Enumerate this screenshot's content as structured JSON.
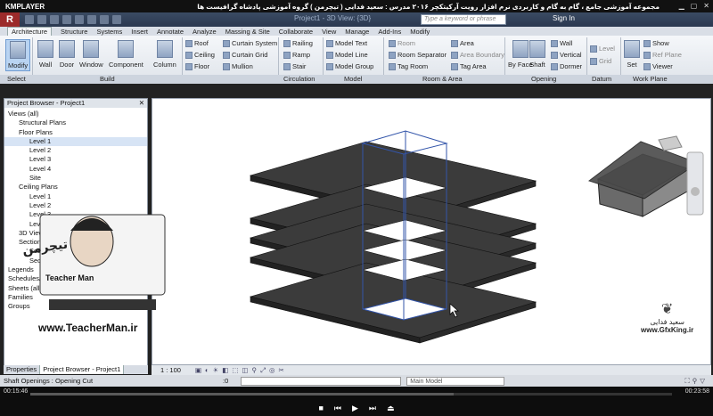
{
  "player": {
    "logo": "KMPLAYER",
    "title": "مجموعه آموزشی جامع ، گام به گام و کاربردی نرم افزار رویت آرکیتکچر ۲۰۱۶ مدرس : سعید فدایی ( تیچرمن ) گروه آموزشی پادشاه گرافیست ها",
    "time_current": "00:15:46",
    "time_total": "00:23:58",
    "progress": 0.66
  },
  "app": {
    "logo": "R",
    "window_title": "Project1 - 3D View: {3D}",
    "search_placeholder": "Type a keyword or phrase",
    "sign_in": "Sign In",
    "tabs": [
      "Architecture",
      "Structure",
      "Systems",
      "Insert",
      "Annotate",
      "Analyze",
      "Massing & Site",
      "Collaborate",
      "View",
      "Manage",
      "Add-Ins",
      "Modify"
    ],
    "active_tab": "Architecture"
  },
  "ribbon": {
    "large": [
      "Modify",
      "Wall",
      "Door",
      "Window",
      "Component",
      "Column",
      "By Face",
      "Shaft",
      "Set"
    ],
    "small": {
      "roof": "Roof",
      "ceiling": "Ceiling",
      "floor": "Floor",
      "curtain_system": "Curtain System",
      "curtain_grid": "Curtain Grid",
      "mullion": "Mullion",
      "railing": "Railing",
      "ramp": "Ramp",
      "stair": "Stair",
      "model_text": "Model Text",
      "model_line": "Model Line",
      "model_group": "Model Group",
      "room": "Room",
      "room_separator": "Room Separator",
      "tag_room": "Tag Room",
      "area": "Area",
      "area_boundary": "Area Boundary",
      "tag_area": "Tag Area",
      "wall": "Wall",
      "vertical": "Vertical",
      "dormer": "Dormer",
      "level": "Level",
      "grid": "Grid",
      "show": "Show",
      "ref_plane": "Ref Plane",
      "viewer": "Viewer"
    },
    "panels": [
      "Select",
      "Build",
      "Circulation",
      "Model",
      "Room & Area",
      "Opening",
      "Datum",
      "Work Plane"
    ]
  },
  "browser": {
    "title": "Project Browser - Project1",
    "tree": [
      {
        "label": "Views (all)",
        "indent": 0
      },
      {
        "label": "Structural Plans",
        "indent": 1
      },
      {
        "label": "Floor Plans",
        "indent": 1
      },
      {
        "label": "Level 1",
        "indent": 2
      },
      {
        "label": "Level 2",
        "indent": 2
      },
      {
        "label": "Level 3",
        "indent": 2
      },
      {
        "label": "Level 4",
        "indent": 2
      },
      {
        "label": "Site",
        "indent": 2
      },
      {
        "label": "Ceiling Plans",
        "indent": 1
      },
      {
        "label": "Level 1",
        "indent": 2
      },
      {
        "label": "Level 2",
        "indent": 2
      },
      {
        "label": "Level 3",
        "indent": 2
      },
      {
        "label": "Level 4",
        "indent": 2
      },
      {
        "label": "3D Views",
        "indent": 1
      },
      {
        "label": "",
        "indent": 1
      },
      {
        "label": "",
        "indent": 1
      },
      {
        "label": "",
        "indent": 1
      },
      {
        "label": "",
        "indent": 1
      },
      {
        "label": "",
        "indent": 1
      },
      {
        "label": "Sections",
        "indent": 1
      },
      {
        "label": "Section 1",
        "indent": 2
      },
      {
        "label": "Section 2",
        "indent": 2
      },
      {
        "label": "Legends",
        "indent": 0
      },
      {
        "label": "Schedules/Quantities",
        "indent": 0
      },
      {
        "label": "Sheets (all)",
        "indent": 0
      },
      {
        "label": "Families",
        "indent": 0
      },
      {
        "label": "Groups",
        "indent": 0
      }
    ],
    "bottom_tabs": [
      "Properties",
      "Project Browser - Project1"
    ]
  },
  "view": {
    "scale": "1 : 100"
  },
  "status": {
    "message": "Shaft Openings : Opening Cut",
    "coord": ":0",
    "model": "Main Model"
  },
  "overlay": {
    "teacher_brand": "تیچرمن",
    "teacher_sub": "Teacher Man",
    "teacher_url": "www.TeacherMan.ir",
    "gfx_name": "سعید فدایی",
    "gfx_url": "www.GfxKing.ir"
  }
}
